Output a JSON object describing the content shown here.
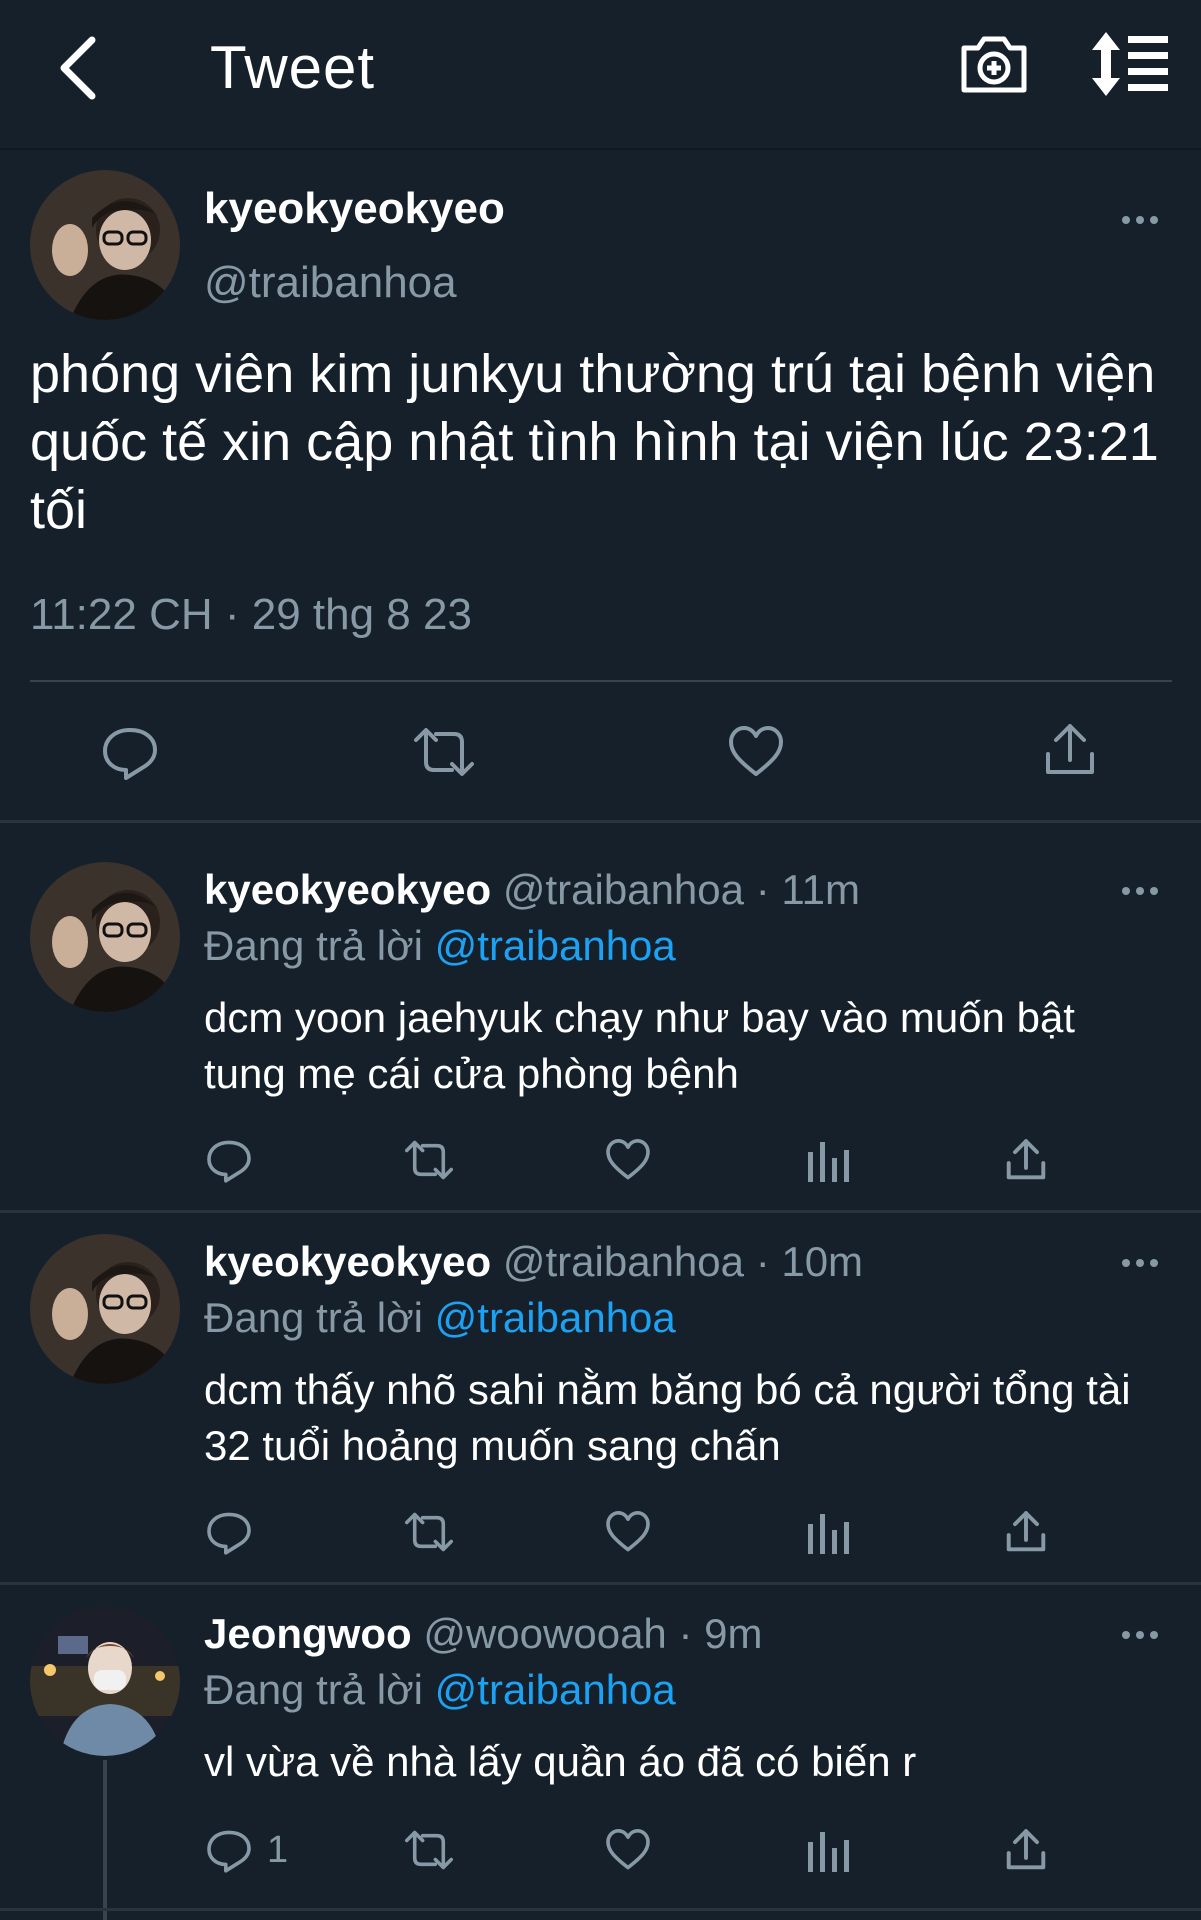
{
  "header": {
    "title": "Tweet",
    "back_icon": "chevron-left-icon",
    "camera_icon": "camera-plus-icon",
    "sort_icon": "sort-list-icon"
  },
  "main_tweet": {
    "name": "kyeokyeokyeo",
    "handle": "@traibanhoa",
    "text": "phóng viên kim junkyu thường trú tại bệnh viện quốc tế xin cập nhật tình hình tại viện lúc 23:21 tối",
    "timestamp": "11:22 CH · 29 thg 8 23"
  },
  "replies": [
    {
      "name": "kyeokyeokyeo",
      "handle": "@traibanhoa",
      "time": "· 11m",
      "replying_label": "Đang trả lời",
      "replying_to": "@traibanhoa",
      "text": "dcm yoon jaehyuk chạy như bay vào muốn bật tung mẹ cái cửa phòng bệnh",
      "reply_count": ""
    },
    {
      "name": "kyeokyeokyeo",
      "handle": "@traibanhoa",
      "time": "· 10m",
      "replying_label": "Đang trả lời",
      "replying_to": "@traibanhoa",
      "text": "dcm thấy nhõ sahi nằm băng bó cả người tổng tài 32 tuổi hoảng muốn sang chấn",
      "reply_count": ""
    },
    {
      "name": "Jeongwoo",
      "handle": "@woowooah",
      "time": "· 9m",
      "replying_label": "Đang trả lời",
      "replying_to": "@traibanhoa",
      "text": "vl vừa về nhà lấy quần áo đã có biến r",
      "reply_count": "1"
    }
  ],
  "colors": {
    "background": "#15202b",
    "secondary_text": "#8899a6",
    "link": "#1da1f2"
  }
}
